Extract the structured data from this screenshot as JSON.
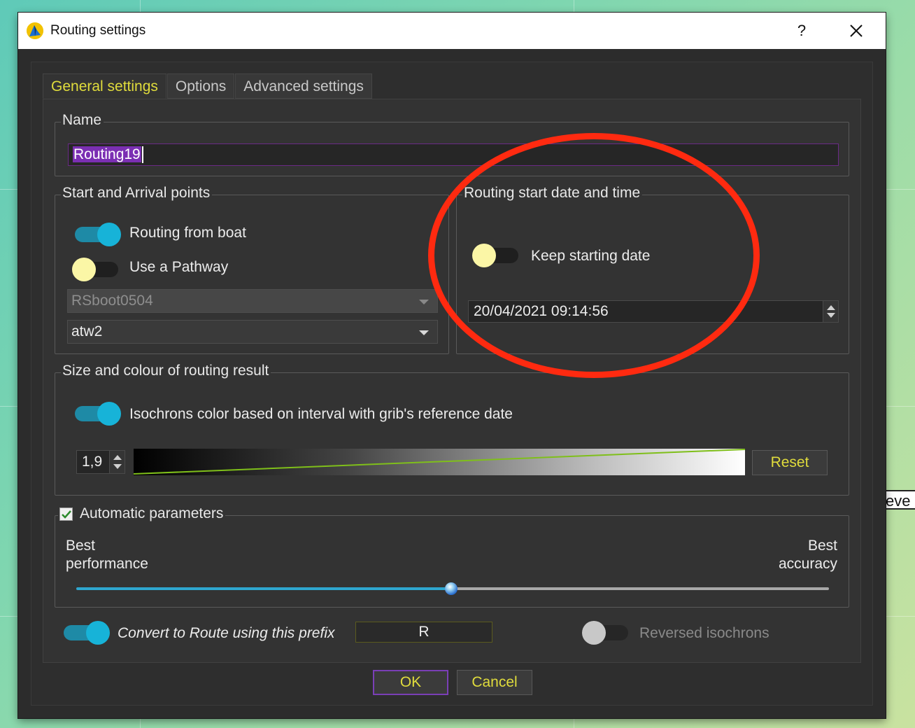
{
  "window": {
    "title": "Routing settings",
    "help_label": "?",
    "close_label": "✕"
  },
  "tabs": [
    {
      "label": "General settings",
      "active": true
    },
    {
      "label": "Options",
      "active": false
    },
    {
      "label": "Advanced settings",
      "active": false
    }
  ],
  "name_group": {
    "title": "Name",
    "value": "Routing19"
  },
  "points_group": {
    "title": "Start and Arrival points",
    "routing_from_boat": {
      "label": "Routing from boat",
      "checked": true
    },
    "use_pathway": {
      "label": "Use a Pathway",
      "checked": false
    },
    "pathway_select": {
      "value": "RSboot0504",
      "enabled": false
    },
    "boat_select": {
      "value": "atw2",
      "enabled": true
    }
  },
  "start_date_group": {
    "title": "Routing start date and time",
    "keep_starting_date": {
      "label": "Keep starting date",
      "checked": false
    },
    "datetime_value": "20/04/2021 09:14:56"
  },
  "size_colour_group": {
    "title": "Size and colour of routing result",
    "isochron_color": {
      "label": "Isochrons color based on interval with grib's reference date",
      "checked": true
    },
    "width_value": "1,9",
    "reset_label": "Reset"
  },
  "automatic_parameters": {
    "title": "Automatic parameters",
    "checked": true,
    "left_label_line1": "Best",
    "left_label_line2": "performance",
    "right_label_line1": "Best",
    "right_label_line2": "accuracy",
    "slider_fraction": 0.5
  },
  "bottom": {
    "convert_route": {
      "label": "Convert to Route using this prefix",
      "checked": true
    },
    "prefix_value": "R",
    "reversed_isochrons": {
      "label": "Reversed isochrons",
      "checked": false,
      "enabled": false
    }
  },
  "buttons": {
    "ok_label": "OK",
    "cancel_label": "Cancel"
  },
  "background": {
    "map_edge_text": "eve"
  },
  "colors": {
    "accent_yellow": "#e0dc3c",
    "toggle_on": "#17b3d8",
    "annotation_red": "#ff2a10",
    "selection_purple": "#7b2fb3"
  }
}
